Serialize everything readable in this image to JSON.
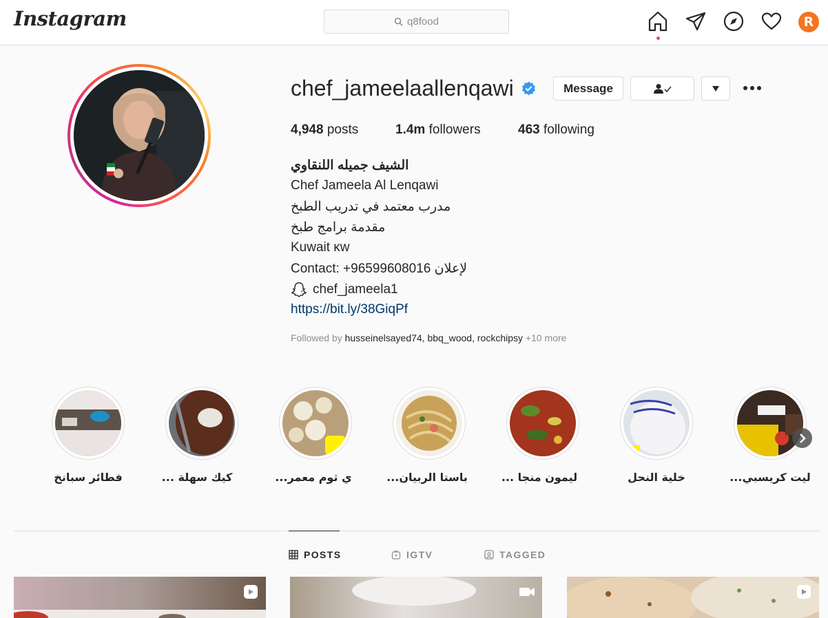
{
  "nav": {
    "logo": "Instagram",
    "search_value": "q8food",
    "avatar_letter": "R"
  },
  "profile": {
    "username": "chef_jameelaallenqawi",
    "message_label": "Message",
    "posts_count": "4,948",
    "posts_label": "posts",
    "followers_count": "1.4m",
    "followers_label": "followers",
    "following_count": "463",
    "following_label": "following",
    "bio": {
      "name": "الشيف جميله اللنقاوي",
      "line1": "Chef Jameela Al Lenqawi",
      "line2": "مدرب معتمد في تدريب الطبخ",
      "line3": "مقدمة برامج طبخ",
      "line4": "Kuwait κw",
      "line5": "Contact: +96599608016 لإعلان",
      "line6": "chef_jameela1",
      "link": "https://bit.ly/38GiqPf"
    },
    "followed_by": {
      "prefix": "Followed by",
      "users": [
        "husseinelsayed74",
        "bbq_wood",
        "rockchipsy"
      ],
      "more": "+10 more"
    }
  },
  "highlights": [
    {
      "label": "فطائر سبانخ"
    },
    {
      "label": "... كيك سهلة"
    },
    {
      "label": "...ي ثوم معمر"
    },
    {
      "label": "...باستا الربيان"
    },
    {
      "label": "... ليمون منجا"
    },
    {
      "label": "خلية النحل"
    },
    {
      "label": "...ليت كريسبي"
    }
  ],
  "tabs": [
    {
      "label": "POSTS",
      "icon": "grid-icon"
    },
    {
      "label": "IGTV",
      "icon": "igtv-icon"
    },
    {
      "label": "TAGGED",
      "icon": "tagged-icon"
    }
  ],
  "colors": {
    "accent": "#0095f6",
    "verified": "#3897f0",
    "notification": "#ed4956",
    "avatar": "#f47521"
  }
}
